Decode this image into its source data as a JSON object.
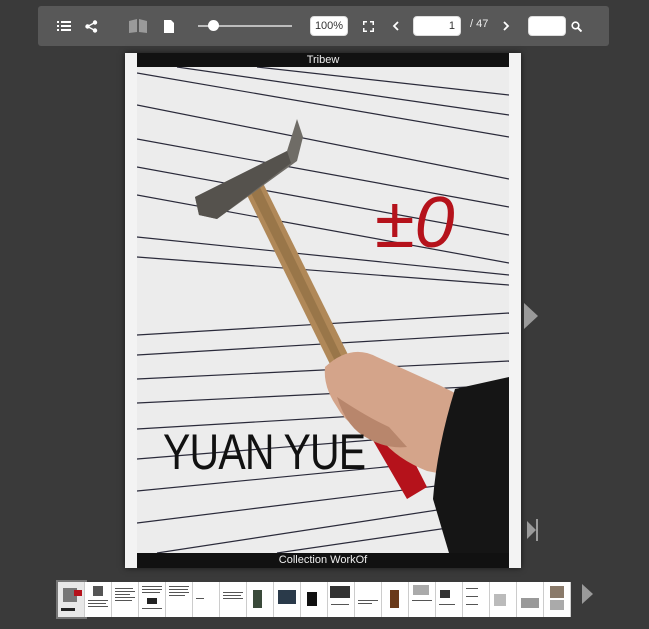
{
  "toolbar": {
    "zoom_value": "100%",
    "page_current": "1",
    "page_total": "/ 47",
    "search_value": "",
    "icons": [
      "list-icon",
      "share-icon",
      "double-page-icon",
      "single-page-icon",
      "fullscreen-icon",
      "prev-page-icon",
      "next-page-icon",
      "search-icon"
    ]
  },
  "page": {
    "top_band": "Tribew",
    "bottom_band": "Collection WorkOf",
    "cover_name": "YUAN YUE",
    "cover_mark": "±0"
  },
  "colors": {
    "background": "#3a3a3a",
    "toolbar": "#585858",
    "accent_red": "#b5121b"
  }
}
